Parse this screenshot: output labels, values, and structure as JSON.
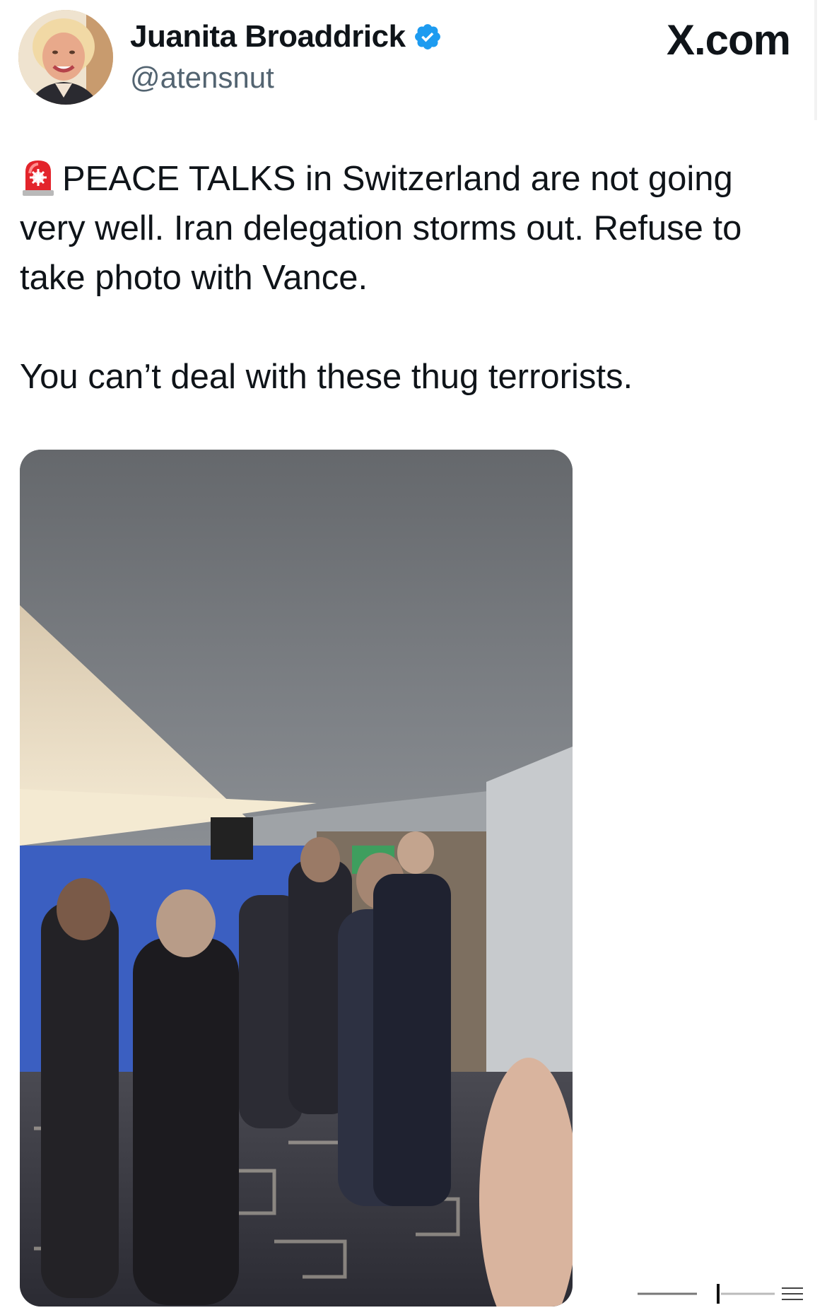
{
  "author": {
    "display_name": "Juanita Broaddrick",
    "handle": "@atensnut",
    "verified": true,
    "avatar_icon": "profile-photo"
  },
  "brand": {
    "label": "X.com"
  },
  "post": {
    "paragraphs": [
      "PEACE TALKS  in Switzerland are not going very well.  Iran delegation storms out.  Refuse to take photo with Vance.",
      "You can’t deal with these thug terrorists."
    ],
    "leading_icon": "rotating-light-siren-icon"
  },
  "media": {
    "kind": "video-still"
  },
  "colors": {
    "text": "#0f1419",
    "secondary_text": "#536471",
    "verified_badge": "#1d9bf0"
  }
}
